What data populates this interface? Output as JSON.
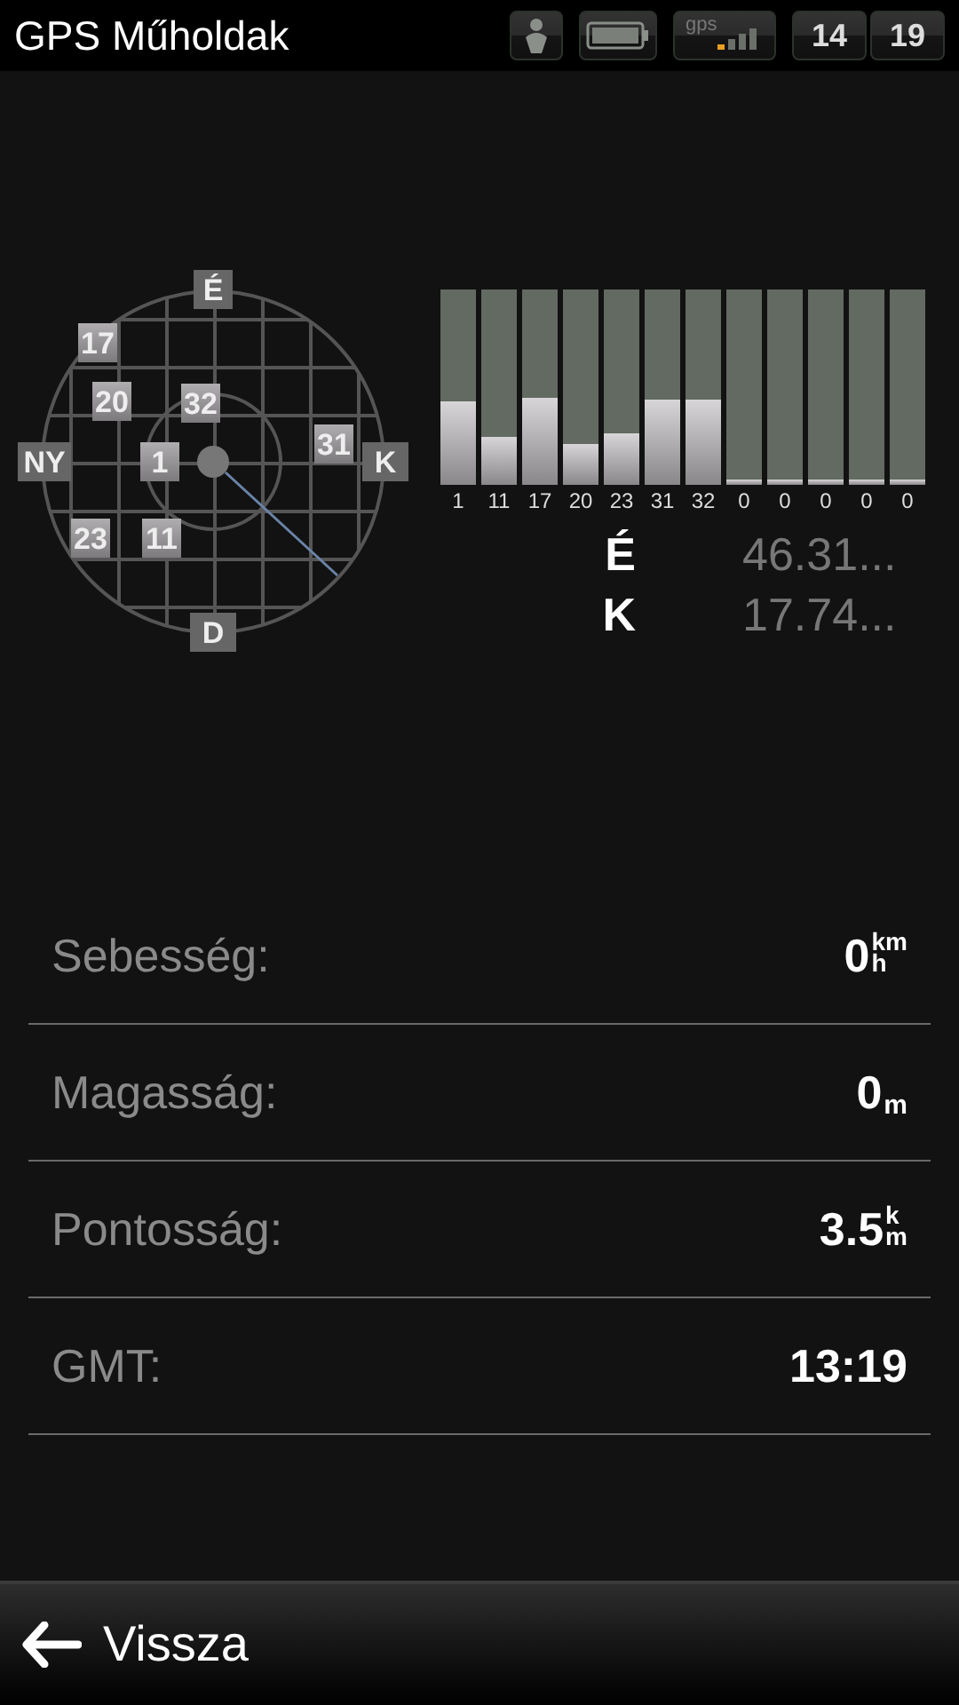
{
  "status_bar": {
    "title": "GPS Műholdak",
    "gps_label": "gps",
    "clock_hours": "14",
    "clock_minutes": "19"
  },
  "skyplot": {
    "compass": [
      "É",
      "K",
      "D",
      "NY"
    ],
    "satellites": [
      "17",
      "20",
      "32",
      "31",
      "1",
      "23",
      "11"
    ]
  },
  "signal_bars": [
    {
      "label": "1",
      "level": 0.43
    },
    {
      "label": "11",
      "level": 0.25
    },
    {
      "label": "17",
      "level": 0.45
    },
    {
      "label": "20",
      "level": 0.21
    },
    {
      "label": "23",
      "level": 0.26
    },
    {
      "label": "31",
      "level": 0.44
    },
    {
      "label": "32",
      "level": 0.44
    },
    {
      "label": "0",
      "level": 0.03
    },
    {
      "label": "0",
      "level": 0.03
    },
    {
      "label": "0",
      "level": 0.03
    },
    {
      "label": "0",
      "level": 0.03
    },
    {
      "label": "0",
      "level": 0.03
    }
  ],
  "coordinates": [
    {
      "axis": "É",
      "value": "46.31..."
    },
    {
      "axis": "K",
      "value": "17.74..."
    }
  ],
  "readings": [
    {
      "label": "Sebesség:",
      "value": "0",
      "kind": "fraction",
      "unit_top": "km",
      "unit_bottom": "h"
    },
    {
      "label": "Magasság:",
      "value": "0",
      "kind": "sub",
      "unit_bottom": "m"
    },
    {
      "label": "Pontosság:",
      "value": "3.5",
      "kind": "fraction",
      "unit_top": "k",
      "unit_bottom": "m"
    },
    {
      "label": "GMT:",
      "value": "13:19",
      "kind": "plain"
    }
  ],
  "back_button": {
    "label": "Vissza"
  }
}
